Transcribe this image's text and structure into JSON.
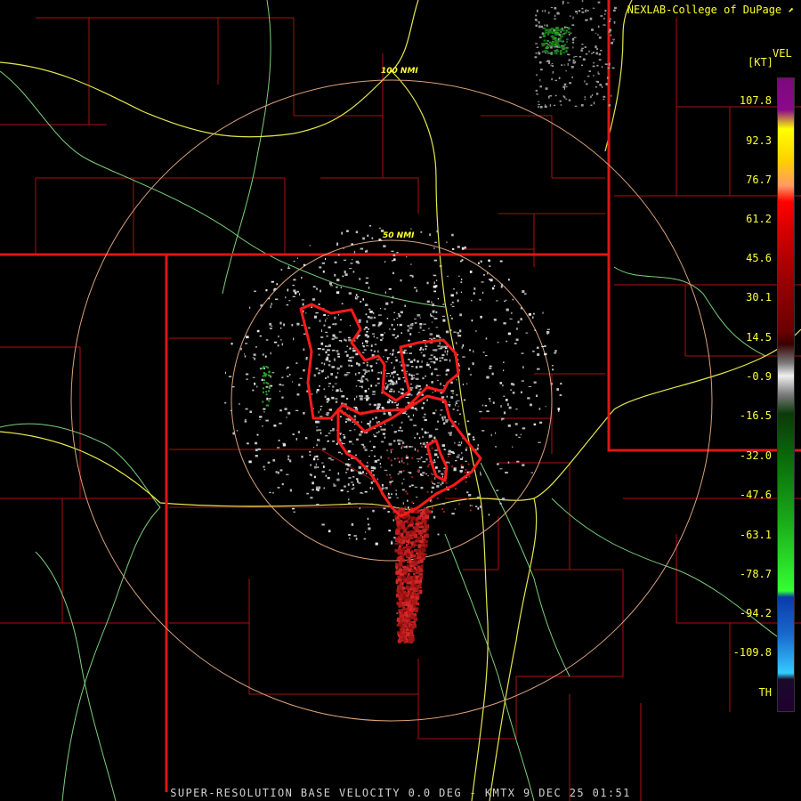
{
  "header": {
    "credit": "NEXLAB-College of DuPage",
    "credit_icon": "external-link-icon"
  },
  "legend": {
    "product": "VEL",
    "unit": "[KT]",
    "values": [
      "107.8",
      "92.3",
      "76.7",
      "61.2",
      "45.6",
      "30.1",
      "14.5",
      "-0.9",
      "-16.5",
      "-32.0",
      "-47.6",
      "-63.1",
      "-78.7",
      "-94.2",
      "-109.8",
      "TH"
    ]
  },
  "range_rings": [
    "100 NMI",
    "50 NMI"
  ],
  "footer": {
    "caption": "SUPER-RESOLUTION BASE VELOCITY 0.0 DEG - KMTX 9 DEC 25 01:51"
  },
  "colors": {
    "background": "#000000",
    "label_text": "#ffff33",
    "state_border": "#dd1111",
    "county_border": "#aa1010",
    "highway": "#e6e64d",
    "road": "#7ccf7c",
    "range_ring": "#d9a27a",
    "warning_polygon": "#ff1a1a",
    "outbound_velocity": "#c41e1e",
    "inbound_velocity": "#1a8c1a",
    "near_zero_velocity": "#bdbdbd"
  }
}
